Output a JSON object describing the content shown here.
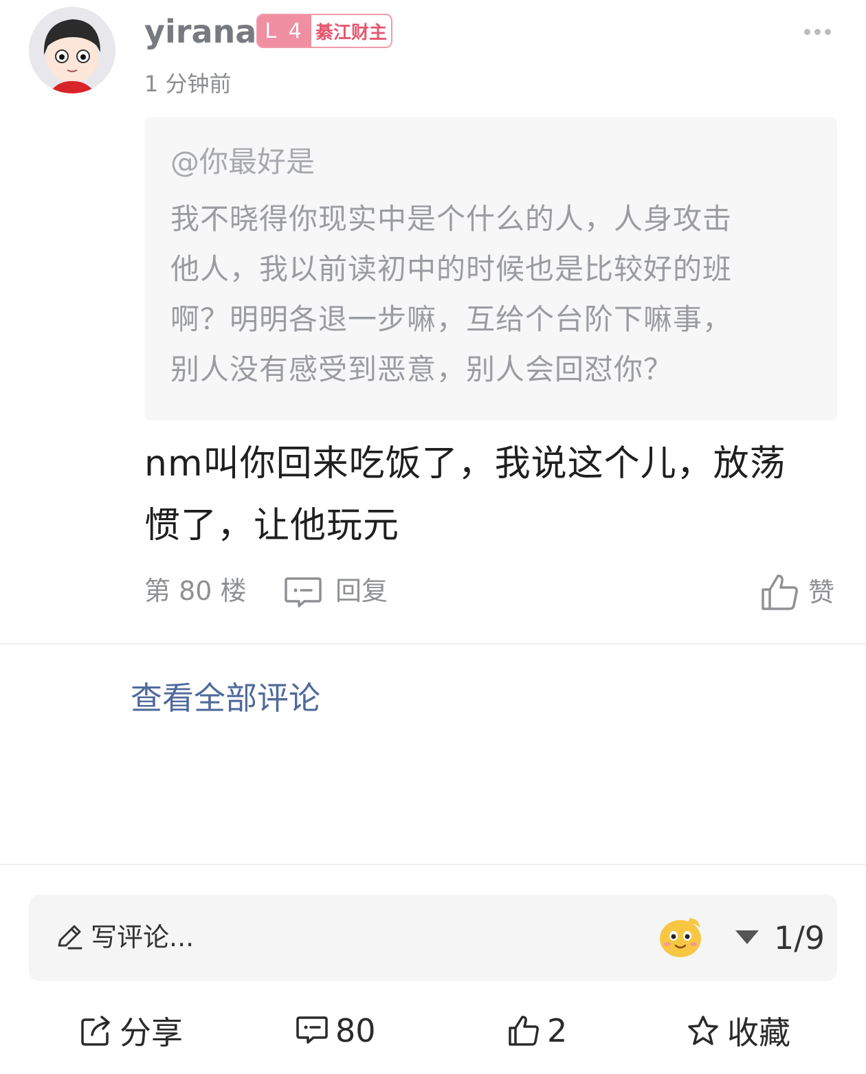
{
  "post": {
    "username": "yirana",
    "level": "L 4",
    "badge_title": "綦江财主",
    "time": "1 分钟前",
    "quote": {
      "mention": "@你最好是",
      "lines": [
        "我不晓得你现实中是个什么的人，人身攻击",
        "他人，我以前读初中的时候也是比较好的班",
        "啊？明明各退一步嘛，互给个台阶下嘛事，",
        "别人没有感受到恶意，别人会回怼你？"
      ]
    },
    "content_lines": [
      "nm叫你回来吃饭了，我说这个儿，放荡",
      "惯了，让他玩元"
    ],
    "floor": "第 80 楼",
    "reply_label": "回复",
    "like_label": "赞"
  },
  "view_all": "查看全部评论",
  "input": {
    "placeholder": "写评论...",
    "pager": "1/9"
  },
  "bottom_bar": {
    "share": "分享",
    "comments": "80",
    "likes": "2",
    "favorite": "收藏"
  },
  "colors": {
    "accent_link": "#4f6a9b",
    "badge_pink": "#f08ea2",
    "badge_text": "#e5576f"
  }
}
